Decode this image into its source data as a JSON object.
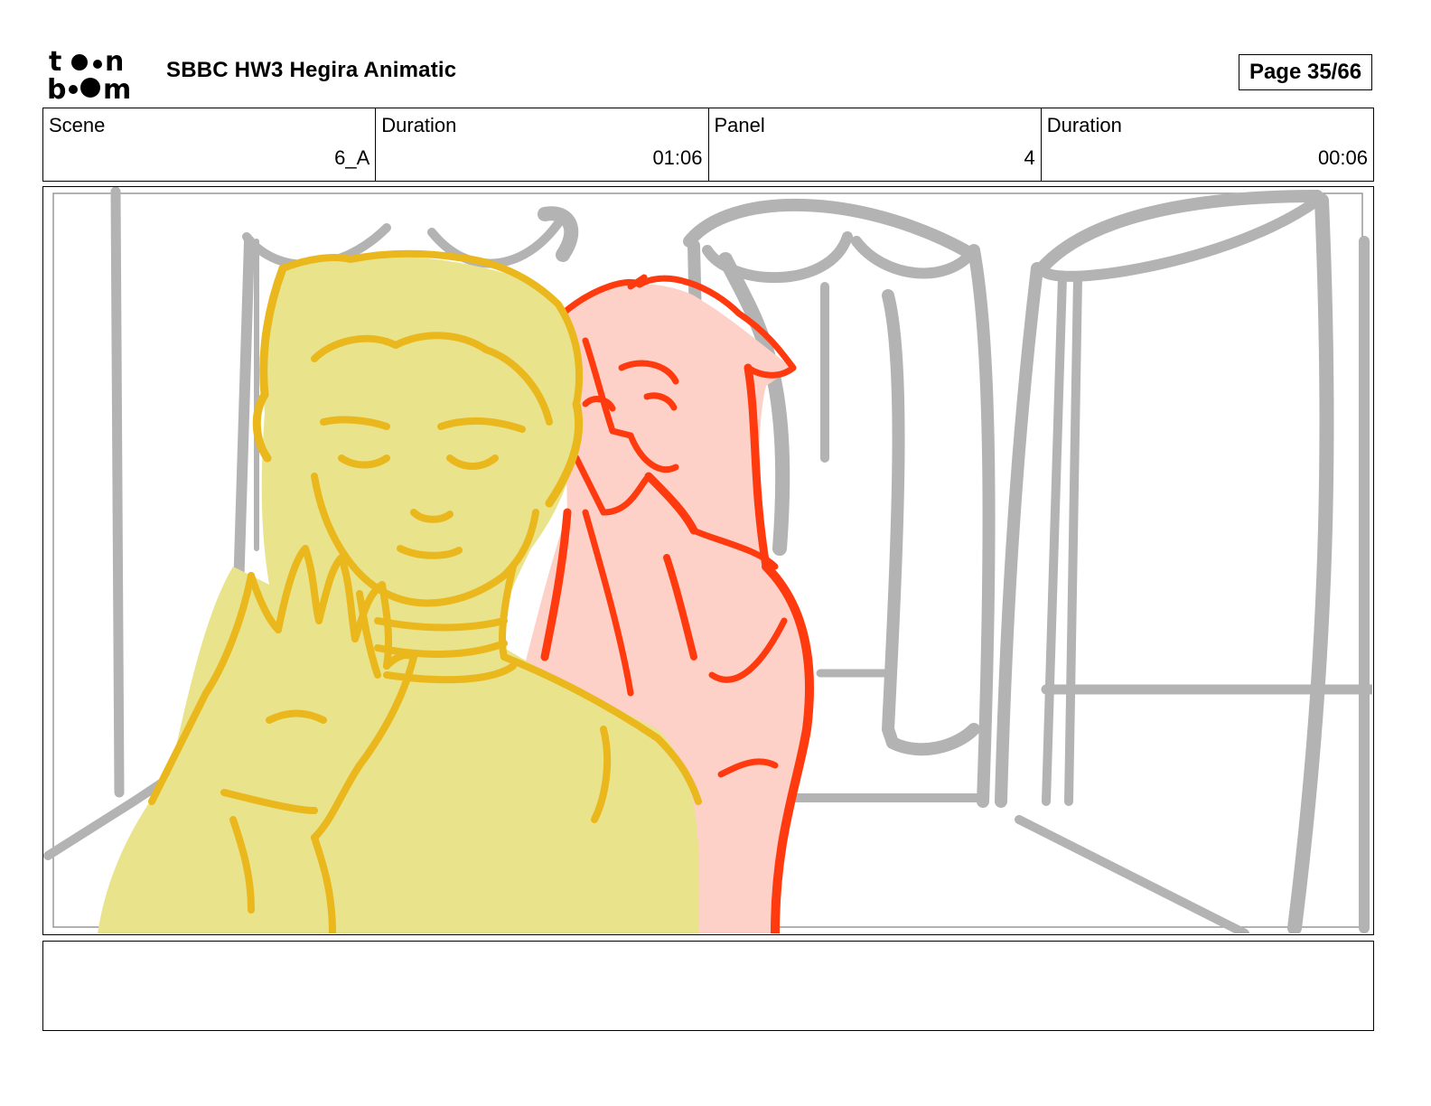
{
  "header": {
    "logo_alt": "toon boom",
    "title": "SBBC HW3 Hegira Animatic",
    "page": "Page 35/66"
  },
  "info": {
    "scene_label": "Scene",
    "scene_value": "6_A",
    "scene_duration_label": "Duration",
    "scene_duration_value": "01:06",
    "panel_label": "Panel",
    "panel_value": "4",
    "panel_duration_label": "Duration",
    "panel_duration_value": "00:06"
  },
  "panel_image": {
    "description_icon": "storyboard-sketch-image",
    "colors": {
      "background_lines": "#b3b3b3",
      "yellow_character_fill": "#e9e38c",
      "yellow_character_line": "#eab71c",
      "red_character_fill": "#fdd0c8",
      "red_character_line": "#ff3a0e"
    }
  },
  "notes": {
    "text": ""
  }
}
